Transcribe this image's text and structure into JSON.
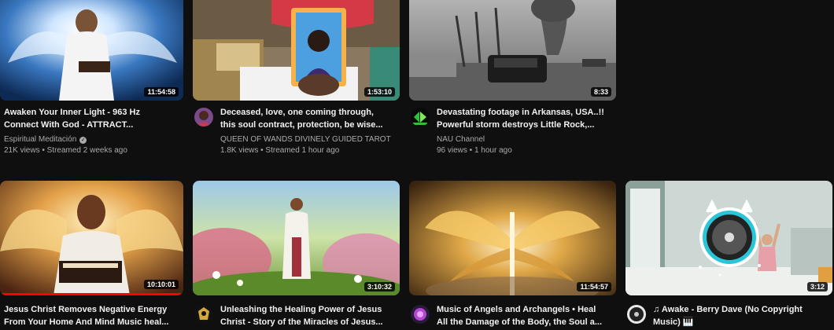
{
  "videos": [
    {
      "title": "Awaken Your Inner Light - 963 Hz\nConnect With God - ATTRACT...",
      "channel": "Espiritual Meditación",
      "verified": true,
      "meta": "21K views • Streamed 2 weeks ago",
      "duration": "11:54:58"
    },
    {
      "title": "Deceased, love, one coming through,\nthis soul contract, protection, be wise...",
      "channel": "QUEEN OF WANDS DIVINELY GUIDED TAROT",
      "meta": "1.8K views • Streamed 1 hour ago",
      "duration": "1:53:10"
    },
    {
      "title": "Devastating footage in Arkansas, USA..!!\nPowerful storm destroys Little Rock,...",
      "channel": "NAU Channel",
      "meta": "96 views • 1 hour ago",
      "duration": "8:33"
    },
    {
      "title": "Jesus Christ Removes Negative Energy\nFrom Your Home And Mind Music heal...",
      "duration": "10:10:01",
      "progress": 1.0
    },
    {
      "title": "Unleashing the Healing Power of Jesus\nChrist - Story of the Miracles of Jesus...",
      "duration": "3:10:32"
    },
    {
      "title": "Music of Angels and Archangels • Heal\nAll the Damage of the Body, the Soul a...",
      "duration": "11:54:57"
    },
    {
      "title": "♫ Awake - Berry Dave (No Copyright\nMusic) 🎹",
      "duration": "3:12"
    }
  ],
  "colors": {
    "background": "#0f0f0f",
    "title": "#f1f1f1",
    "secondary": "#aaaaaa",
    "progress": "#ff0000"
  }
}
